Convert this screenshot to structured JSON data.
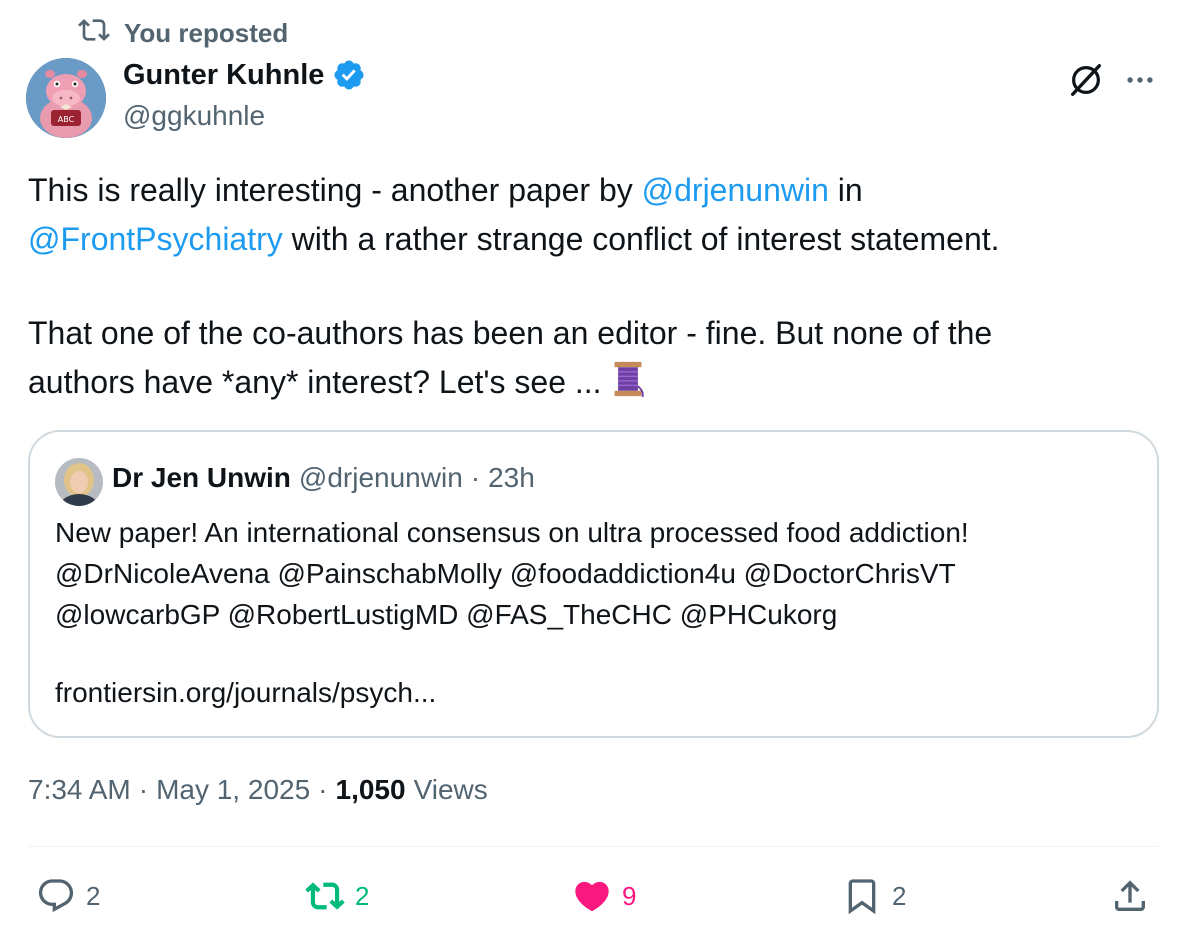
{
  "repost_context": {
    "label": "You reposted",
    "icon": "repost-icon"
  },
  "author": {
    "display_name": "Gunter Kuhnle",
    "handle": "@ggkuhnle",
    "verified": true,
    "avatar_icon": "hippo-avatar"
  },
  "header_actions": {
    "grok_icon": "grok-icon",
    "more_icon": "more-dots-icon"
  },
  "tweet": {
    "line1_pre": "This is really interesting - another paper by ",
    "line1_mention": "@drjenunwin",
    "line1_post": " in",
    "line2_mention": "@FrontPsychiatry",
    "line2_post": " with a rather strange conflict of interest statement.",
    "line3": "That one of the co-authors has been an editor - fine. But none of the",
    "line4": "authors have *any* interest? Let's see ... ",
    "thread_emoji": "spool-of-thread-emoji"
  },
  "quoted": {
    "display_name": "Dr Jen Unwin",
    "handle": "@drjenunwin",
    "separator": "·",
    "time": "23h",
    "line1": "New paper! An international consensus on ultra processed food addiction!",
    "line2": "@DrNicoleAvena @PainschabMolly @foodaddiction4u @DoctorChrisVT",
    "line3": "@lowcarbGP @RobertLustigMD @FAS_TheCHC @PHCukorg",
    "link": "frontiersin.org/journals/psych..."
  },
  "meta": {
    "time": "7:34 AM",
    "sep1": "·",
    "date": "May 1, 2025",
    "sep2": "·",
    "views_count": "1,050",
    "views_label": "Views"
  },
  "actions": {
    "replies": "2",
    "reposts": "2",
    "likes": "9",
    "bookmarks": "2"
  },
  "colors": {
    "accent": "#1d9bf0",
    "repost_active": "#00ba7c",
    "like_active": "#f91880",
    "secondary_text": "#536471",
    "border": "#cfd9de"
  }
}
